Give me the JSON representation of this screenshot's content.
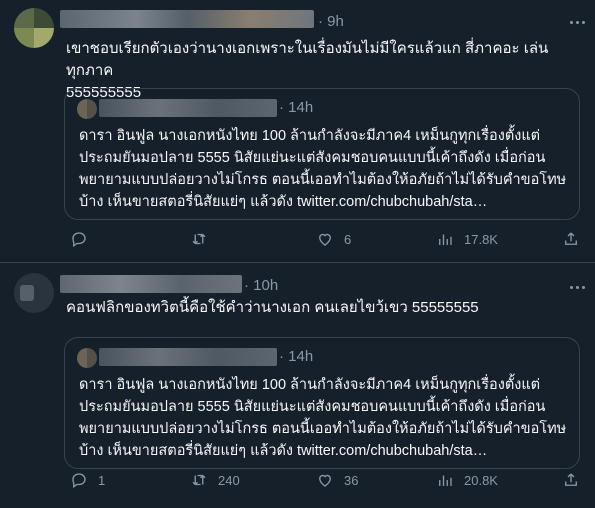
{
  "tweets": [
    {
      "time": "9h",
      "text": "เขาชอบเรียกตัวเองว่านางเอกเพราะในเรื่องมันไม่มีใครแล้วแก สี่ภาคอะ เล่นทุกภาค\n555555555",
      "quote": {
        "time": "14h",
        "text": "ดารา อินฟูล นางเอกหนังไทย 100 ล้านกำลังจะมีภาค4  เหม็นกูทุกเรื่องตั้งแต่ประถมยันมอปลาย 5555 นิสัยแย่นะแต่สังคมชอบคนแบบนี้เค้าถึงดัง  เมื่อก่อนพยายามแบบปล่อยวางไม่โกรธ ตอนนี้เออทำไมต้องให้อภัยถ้าไม่ได้รับคำขอโทษบ้าง เห็นขายสตอรี่นิสัยแย่ๆ แล้วดัง twitter.com/chubchubah/sta…"
      },
      "actions": {
        "reply": "",
        "retweet": "",
        "like": "6",
        "views": "17.8K"
      }
    },
    {
      "time": "10h",
      "text": "คอนฟลิกของทวิตนี้คือใช้คำว่านางเอก คนเลยไขว้เขว 55555555",
      "quote": {
        "time": "14h",
        "text": "ดารา อินฟูล นางเอกหนังไทย 100 ล้านกำลังจะมีภาค4  เหม็นกูทุกเรื่องตั้งแต่ประถมยันมอปลาย 5555 นิสัยแย่นะแต่สังคมชอบคนแบบนี้เค้าถึงดัง  เมื่อก่อนพยายามแบบปล่อยวางไม่โกรธ ตอนนี้เออทำไมต้องให้อภัยถ้าไม่ได้รับคำขอโทษบ้าง เห็นขายสตอรี่นิสัยแย่ๆ แล้วดัง twitter.com/chubchubah/sta…"
      },
      "actions": {
        "reply": "1",
        "retweet": "240",
        "like": "36",
        "views": "20.8K"
      }
    }
  ],
  "colors": {
    "background": "#15202b",
    "border": "#38444d",
    "text": "#f7f9f9",
    "muted": "#8b98a5"
  },
  "icons": [
    "reply-icon",
    "retweet-icon",
    "like-icon",
    "views-icon",
    "share-icon",
    "more-icon"
  ]
}
